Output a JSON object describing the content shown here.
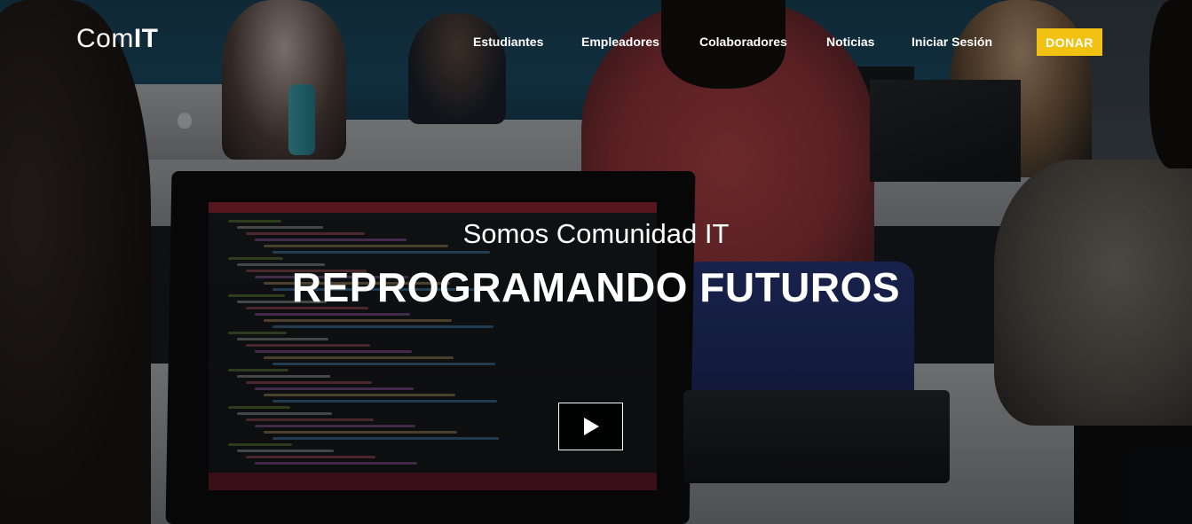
{
  "header": {
    "logo": {
      "light": "Com",
      "bold": "IT"
    },
    "nav": [
      {
        "label": "Estudiantes"
      },
      {
        "label": "Empleadores"
      },
      {
        "label": "Colaboradores"
      },
      {
        "label": "Noticias"
      },
      {
        "label": "Iniciar Sesión"
      }
    ],
    "donate_label": "DONAR"
  },
  "hero": {
    "subtitle": "Somos Comunidad IT",
    "title": "REPROGRAMANDO FUTUROS",
    "play_icon": "play-icon"
  },
  "colors": {
    "donate_bg": "#f2c212",
    "text": "#ffffff",
    "play_bg": "#000000"
  }
}
